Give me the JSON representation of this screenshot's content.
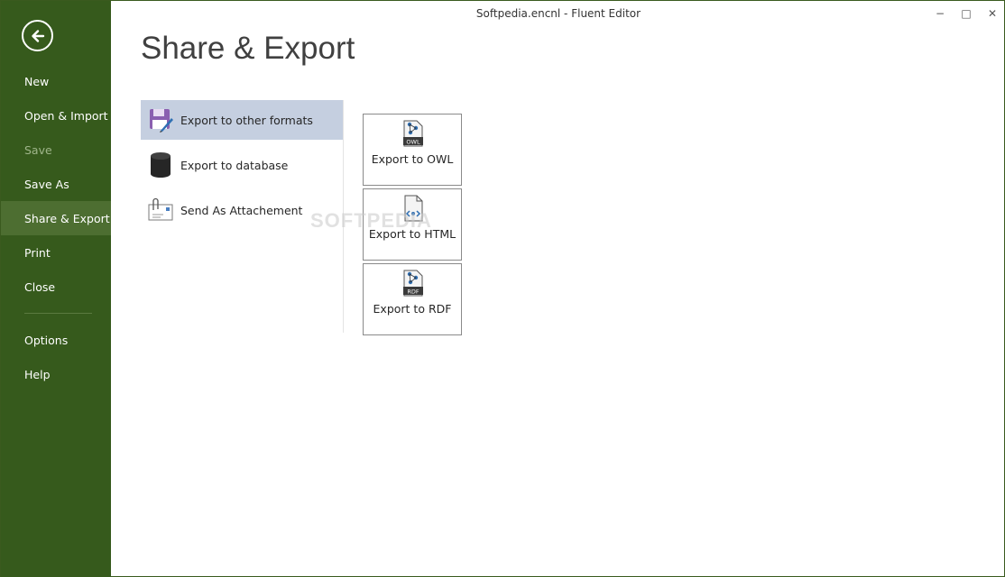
{
  "window": {
    "title": "Softpedia.encnl - Fluent Editor",
    "controls": {
      "minimize": "−",
      "maximize": "□",
      "close": "✕"
    }
  },
  "sidebar": {
    "back_icon": "back-arrow-icon",
    "items": [
      {
        "label": "New",
        "state": "normal"
      },
      {
        "label": "Open & Import",
        "state": "normal"
      },
      {
        "label": "Save",
        "state": "disabled"
      },
      {
        "label": "Save As",
        "state": "normal"
      },
      {
        "label": "Share & Export",
        "state": "active"
      },
      {
        "label": "Print",
        "state": "normal"
      },
      {
        "label": "Close",
        "state": "normal"
      },
      {
        "label": "Options",
        "state": "normal"
      },
      {
        "label": "Help",
        "state": "normal"
      }
    ]
  },
  "main": {
    "title": "Share & Export",
    "options": [
      {
        "label": "Export to other formats",
        "icon": "floppy-export-icon",
        "selected": true
      },
      {
        "label": "Export to database",
        "icon": "database-icon",
        "selected": false
      },
      {
        "label": "Send As Attachement",
        "icon": "email-attachment-icon",
        "selected": false
      }
    ],
    "tiles": [
      {
        "label": "Export to OWL",
        "badge": "OWL",
        "icon": "owl-file-icon"
      },
      {
        "label": "Export to HTML",
        "badge": "",
        "icon": "html-file-icon"
      },
      {
        "label": "Export to RDF",
        "badge": "RDF",
        "icon": "rdf-file-icon"
      }
    ]
  },
  "watermark": "SOFTPEDIA",
  "colors": {
    "sidebar_bg": "#365a1c",
    "sidebar_active": "#4d6e31",
    "option_selected": "#c5cfe0"
  }
}
